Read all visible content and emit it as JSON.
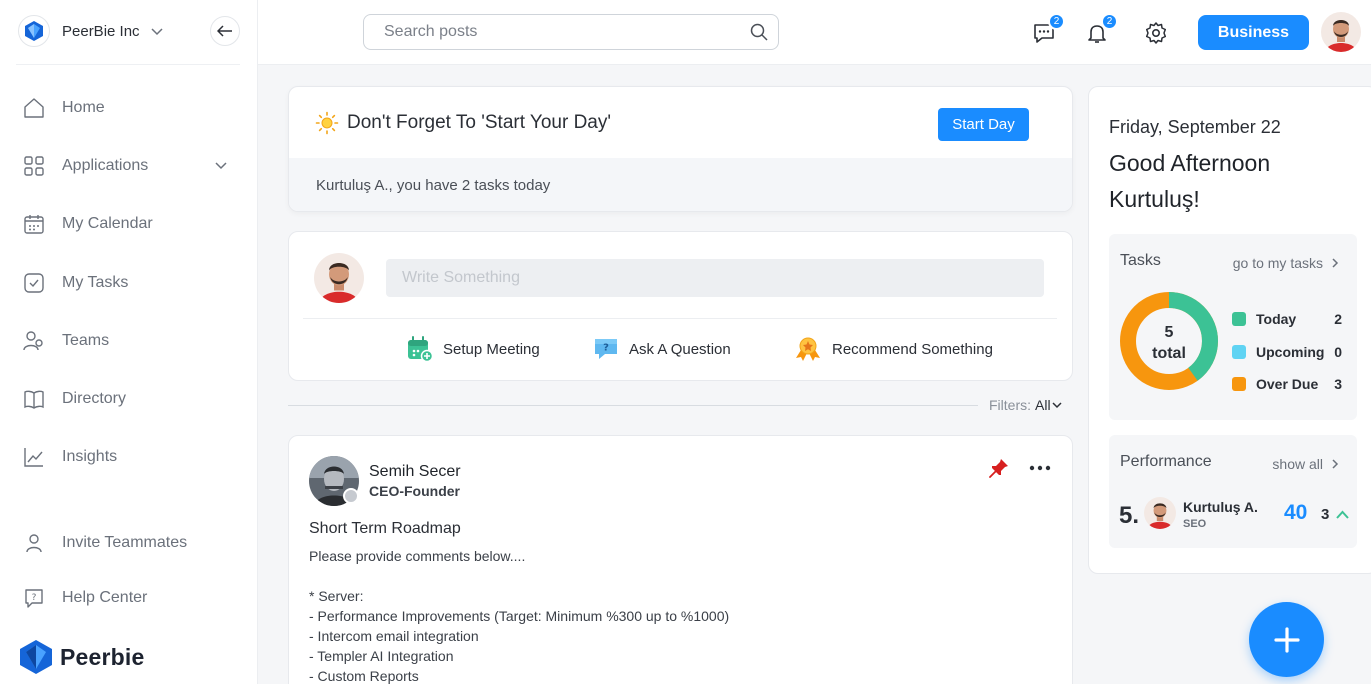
{
  "org": {
    "name": "PeerBie Inc"
  },
  "sidebar": {
    "items": [
      {
        "label": "Home"
      },
      {
        "label": "Applications"
      },
      {
        "label": "My Calendar"
      },
      {
        "label": "My Tasks"
      },
      {
        "label": "Teams"
      },
      {
        "label": "Directory"
      },
      {
        "label": "Insights"
      }
    ],
    "footer_items": [
      {
        "label": "Invite Teammates"
      },
      {
        "label": "Help Center"
      }
    ],
    "brand": "Peerbie"
  },
  "topbar": {
    "search_placeholder": "Search posts",
    "messages_badge": "2",
    "notifications_badge": "2",
    "business_label": "Business"
  },
  "start_day": {
    "title": "Don't Forget To 'Start Your Day'",
    "button": "Start Day",
    "message": "Kurtuluş A., you have 2 tasks today"
  },
  "composer": {
    "placeholder": "Write Something",
    "actions": [
      {
        "label": "Setup Meeting"
      },
      {
        "label": "Ask A Question"
      },
      {
        "label": "Recommend Something"
      }
    ]
  },
  "filters": {
    "label": "Filters:",
    "value": "All"
  },
  "post": {
    "author": "Semih Secer",
    "role": "CEO-Founder",
    "title": "Short Term Roadmap",
    "lines": [
      "Please provide comments below....",
      "",
      "* Server:",
      "- Performance Improvements (Target: Minimum %300 up to %1000)",
      "- Intercom email integration",
      "- Templer AI Integration",
      "- Custom Reports"
    ]
  },
  "right_panel": {
    "date": "Friday, September 22",
    "greeting": "Good Afternoon Kurtuluş!",
    "tasks": {
      "title": "Tasks",
      "link": "go to my tasks",
      "total_number": "5",
      "total_label": "total",
      "legend": [
        {
          "label": "Today",
          "count": "2",
          "color": "#3cc295"
        },
        {
          "label": "Upcoming",
          "count": "0",
          "color": "#5fd3f3"
        },
        {
          "label": "Over Due",
          "count": "3",
          "color": "#f7960e"
        }
      ]
    },
    "performance": {
      "title": "Performance",
      "link": "show all",
      "rank": "5.",
      "name": "Kurtuluş A.",
      "dept": "SEO",
      "score": "40",
      "change": "3"
    }
  },
  "colors": {
    "accent": "#1a8cff",
    "today": "#3cc295",
    "upcoming": "#5fd3f3",
    "overdue": "#f7960e"
  }
}
